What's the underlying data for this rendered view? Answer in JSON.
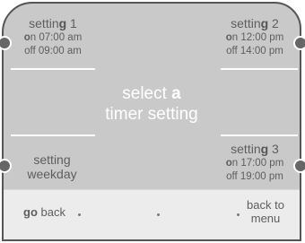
{
  "slot1": {
    "name_prefix": "settin",
    "name_bold": "g",
    "name_suffix": " 1",
    "on_bold": "o",
    "on_rest": "n 07:00 am",
    "off": "off 09:00 am"
  },
  "slot2": {
    "name_prefix": "settin",
    "name_bold": "g",
    "name_suffix": " 2",
    "on_bold": "o",
    "on_rest": "n 12:00 pm",
    "off": "off 14:00 pm"
  },
  "slot3": {
    "name_prefix": "settin",
    "name_bold": "g",
    "name_suffix": " 3",
    "on_bold": "o",
    "on_rest": "n 17:00 pm",
    "off": "off 19:00 pm"
  },
  "weekday": {
    "line1": "setting",
    "line2": "weekday"
  },
  "center": {
    "line1_prefix": "select ",
    "line1_bold": "a",
    "line2": "timer setting"
  },
  "footer": {
    "go_back_bold": "go",
    "go_back_rest": " back",
    "back_to_menu_line1": "back to",
    "back_to_menu_line2": "menu"
  },
  "colors": {
    "panel": "#c9c9c9",
    "footer": "#ececec",
    "text": "#5e5e5e",
    "accent": "#ffffff",
    "handle": "#666666"
  }
}
